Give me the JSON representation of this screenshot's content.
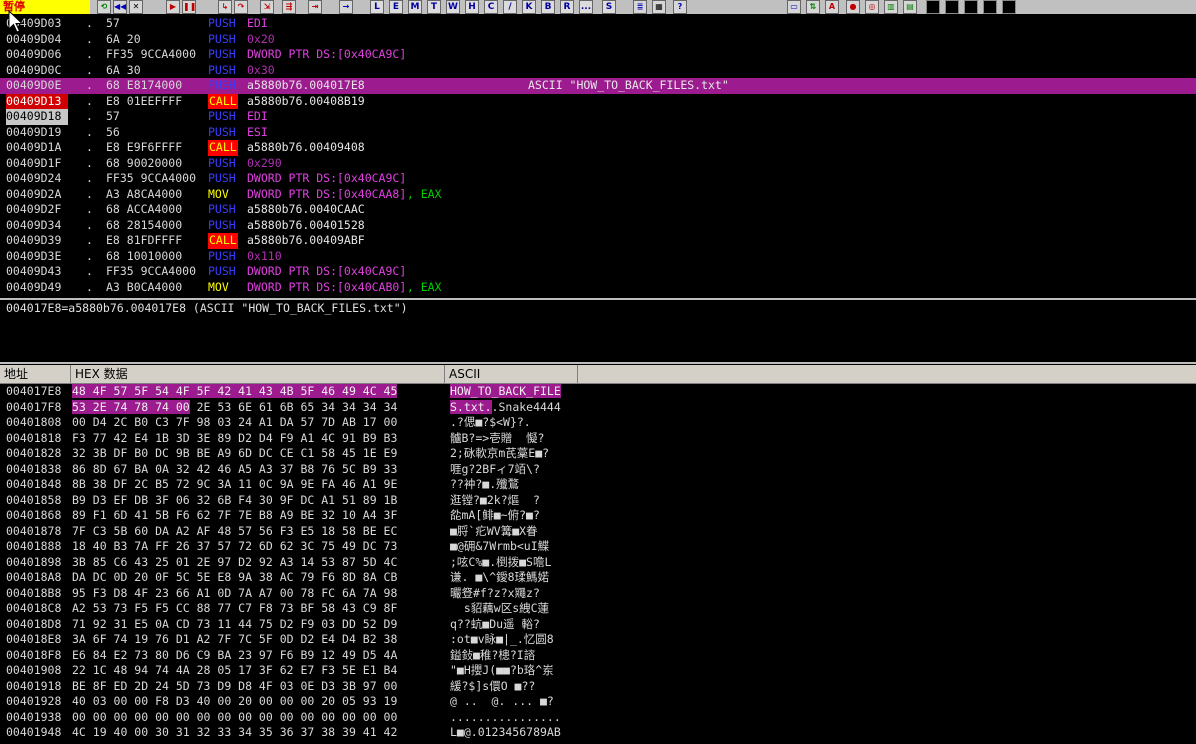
{
  "toolbar": {
    "status": "暂停",
    "letters": [
      "L",
      "E",
      "M",
      "T",
      "W",
      "H",
      "C",
      "/",
      "K",
      "B",
      "R",
      "...",
      "S"
    ]
  },
  "disasm": [
    {
      "addr": "00409D03",
      "hex": "57",
      "mnem": "PUSH",
      "op": "EDI",
      "op_type": "reg_mag"
    },
    {
      "addr": "00409D04",
      "hex": "6A 20",
      "mnem": "PUSH",
      "op": "0x20",
      "op_type": "const"
    },
    {
      "addr": "00409D06",
      "hex": "FF35 9CCA4000",
      "mnem": "PUSH",
      "op": "DWORD PTR DS:[0x40CA9C]",
      "op_type": "mem"
    },
    {
      "addr": "00409D0C",
      "hex": "6A 30",
      "mnem": "PUSH",
      "op": "0x30",
      "op_type": "const"
    },
    {
      "addr": "00409D0E",
      "hex": "68 E8174000",
      "mnem": "PUSH",
      "op": "a5880b76.004017E8",
      "op_type": "plain",
      "comment": "ASCII \"HOW_TO_BACK_FILES.txt\"",
      "selected": true
    },
    {
      "addr": "00409D13",
      "hex": "E8 01EEFFFF",
      "mnem": "CALL",
      "op": "a5880b76.00408B19",
      "op_type": "plain",
      "addr_style": "red"
    },
    {
      "addr": "00409D18",
      "hex": "57",
      "mnem": "PUSH",
      "op": "EDI",
      "op_type": "reg_mag",
      "addr_style": "gray"
    },
    {
      "addr": "00409D19",
      "hex": "56",
      "mnem": "PUSH",
      "op": "ESI",
      "op_type": "reg_mag"
    },
    {
      "addr": "00409D1A",
      "hex": "E8 E9F6FFFF",
      "mnem": "CALL",
      "op": "a5880b76.00409408",
      "op_type": "plain"
    },
    {
      "addr": "00409D1F",
      "hex": "68 90020000",
      "mnem": "PUSH",
      "op": "0x290",
      "op_type": "const"
    },
    {
      "addr": "00409D24",
      "hex": "FF35 9CCA4000",
      "mnem": "PUSH",
      "op": "DWORD PTR DS:[0x40CA9C]",
      "op_type": "mem"
    },
    {
      "addr": "00409D2A",
      "hex": "A3 A8CA4000",
      "mnem": "MOV",
      "op": "DWORD PTR DS:[0x40CAA8]",
      "op2": ", EAX",
      "op_type": "mem"
    },
    {
      "addr": "00409D2F",
      "hex": "68 ACCA4000",
      "mnem": "PUSH",
      "op": "a5880b76.0040CAAC",
      "op_type": "plain"
    },
    {
      "addr": "00409D34",
      "hex": "68 28154000",
      "mnem": "PUSH",
      "op": "a5880b76.00401528",
      "op_type": "plain"
    },
    {
      "addr": "00409D39",
      "hex": "E8 81FDFFFF",
      "mnem": "CALL",
      "op": "a5880b76.00409ABF",
      "op_type": "plain"
    },
    {
      "addr": "00409D3E",
      "hex": "68 10010000",
      "mnem": "PUSH",
      "op": "0x110",
      "op_type": "const"
    },
    {
      "addr": "00409D43",
      "hex": "FF35 9CCA4000",
      "mnem": "PUSH",
      "op": "DWORD PTR DS:[0x40CA9C]",
      "op_type": "mem"
    },
    {
      "addr": "00409D49",
      "hex": "A3 B0CA4000",
      "mnem": "MOV",
      "op": "DWORD PTR DS:[0x40CAB0]",
      "op2": ", EAX",
      "op_type": "mem"
    }
  ],
  "dot": ".",
  "info_line": "004017E8=a5880b76.004017E8 (ASCII \"HOW_TO_BACK_FILES.txt\")",
  "dump": {
    "headers": {
      "addr": "地址",
      "hex": "HEX 数据",
      "ascii": "ASCII"
    },
    "rows": [
      {
        "addr": "004017E8",
        "hex": "48 4F 57 5F 54 4F 5F 42 41 43 4B 5F 46 49 4C 45",
        "ascii": "HOW_TO_BACK_FILE",
        "hl": 16
      },
      {
        "addr": "004017F8",
        "hex": "53 2E 74 78 74 00 2E 53 6E 61 6B 65 34 34 34 34",
        "ascii": "S.txt..Snake4444",
        "hl": 6
      },
      {
        "addr": "00401808",
        "hex": "00 D4 2C B0 C3 7F 98 03 24 A1 DA 57 7D AB 17 00",
        "ascii": ".?偲■?$<W}?."
      },
      {
        "addr": "00401818",
        "hex": "F3 77 42 E4 1B 3D 3E 89 D2 D4 F9 A1 4C 91 B9 B3",
        "ascii": "髗B?=>壱贈  懝?"
      },
      {
        "addr": "00401828",
        "hex": "32 3B DF B0 DC 9B BE A9 6D DC CE C1 58 45 1E E9",
        "ascii": "2;砯軟京m芪藳E■?"
      },
      {
        "addr": "00401838",
        "hex": "86 8D 67 BA 0A 32 42 46 A5 A3 37 B8 76 5C B9 33",
        "ascii": "啀g?2BFィ7竡\\?"
      },
      {
        "addr": "00401848",
        "hex": "8B 38 DF 2C B5 72 9C 3A 11 0C 9A 9E FA 46 A1 9E",
        "ascii": "??衶?■.殲鶩"
      },
      {
        "addr": "00401858",
        "hex": "B9 D3 EF DB 3F 06 32 6B F4 30 9F DC A1 51 89 1B",
        "ascii": "逛镗?■2k?熰  ?"
      },
      {
        "addr": "00401868",
        "hex": "89 F1 6D 41 5B F6 62 7F 7E B8 A9 BE 32 10 A4 3F",
        "ascii": "夞mA[鲱■~俯?■?"
      },
      {
        "addr": "00401878",
        "hex": "7F C3 5B 60 DA A2 AF 48 57 56 F3 E5 18 58 BE EC",
        "ascii": "■脟`疕WV篝■X眷"
      },
      {
        "addr": "00401888",
        "hex": "18 40 B3 7A FF 26 37 57 72 6D 62 3C 75 49 DC 73",
        "ascii": "■@砽&7Wrmb<uI鰈"
      },
      {
        "addr": "00401898",
        "hex": "3B 85 C6 43 25 01 2E 97 D2 92 A3 14 53 87 5D 4C",
        "ascii": ";呟C%■.椡拨■S噡L"
      },
      {
        "addr": "004018A8",
        "hex": "DA DC 0D 20 0F 5C 5E E8 9A 38 AC 79 F6 8D 8A CB",
        "ascii": "谦. ■\\^鑀8瑈鰢婼"
      },
      {
        "addr": "004018B8",
        "hex": "95 F3 D8 4F 23 66 A1 0D 7A A7 00 78 FC 6A 7A 98",
        "ascii": "曮豋#f?z?x鼆z?"
      },
      {
        "addr": "004018C8",
        "hex": "A2 53 73 F5 F5 CC 88 77 C7 F8 73 BF 58 43 C9 8F",
        "ascii": "  s貂藕w区s絏C蓮"
      },
      {
        "addr": "004018D8",
        "hex": "71 92 31 E5 0A CD 73 11 44 75 D2 F9 03 DD 52 D9",
        "ascii": "q??蚢■Du遥 輍?"
      },
      {
        "addr": "004018E8",
        "hex": "3A 6F 74 19 76 D1 A2 7F 7C 5F 0D D2 E4 D4 B2 38",
        "ascii": ":ot■v眿■|_.忆圆8"
      },
      {
        "addr": "004018F8",
        "hex": "E6 84 E2 73 80 D6 C9 BA 23 97 F6 B9 12 49 D5 4A",
        "ascii": "鎰鈙■稚?槵?I諮"
      },
      {
        "addr": "00401908",
        "hex": "22 1C 48 94 74 4A 28 05 17 3F 62 E7 F3 5E E1 B4",
        "ascii": "\"■H攖J(■■?b珞^岽"
      },
      {
        "addr": "00401918",
        "hex": "BE 8F ED 2D 24 5D 73 D9 D8 4F 03 0E D3 3B 97 00",
        "ascii": "緩?$]s儇O ■??"
      },
      {
        "addr": "00401928",
        "hex": "40 03 00 00 F8 D3 40 00 20 00 00 00 20 05 93 19",
        "ascii": "@ ..  @. ... ■?"
      },
      {
        "addr": "00401938",
        "hex": "00 00 00 00 00 00 00 00 00 00 00 00 00 00 00 00",
        "ascii": "................"
      },
      {
        "addr": "00401948",
        "hex": "4C 19 40 00 30 31 32 33 34 35 36 37 38 39 41 42",
        "ascii": "L■@.0123456789AB"
      }
    ]
  }
}
